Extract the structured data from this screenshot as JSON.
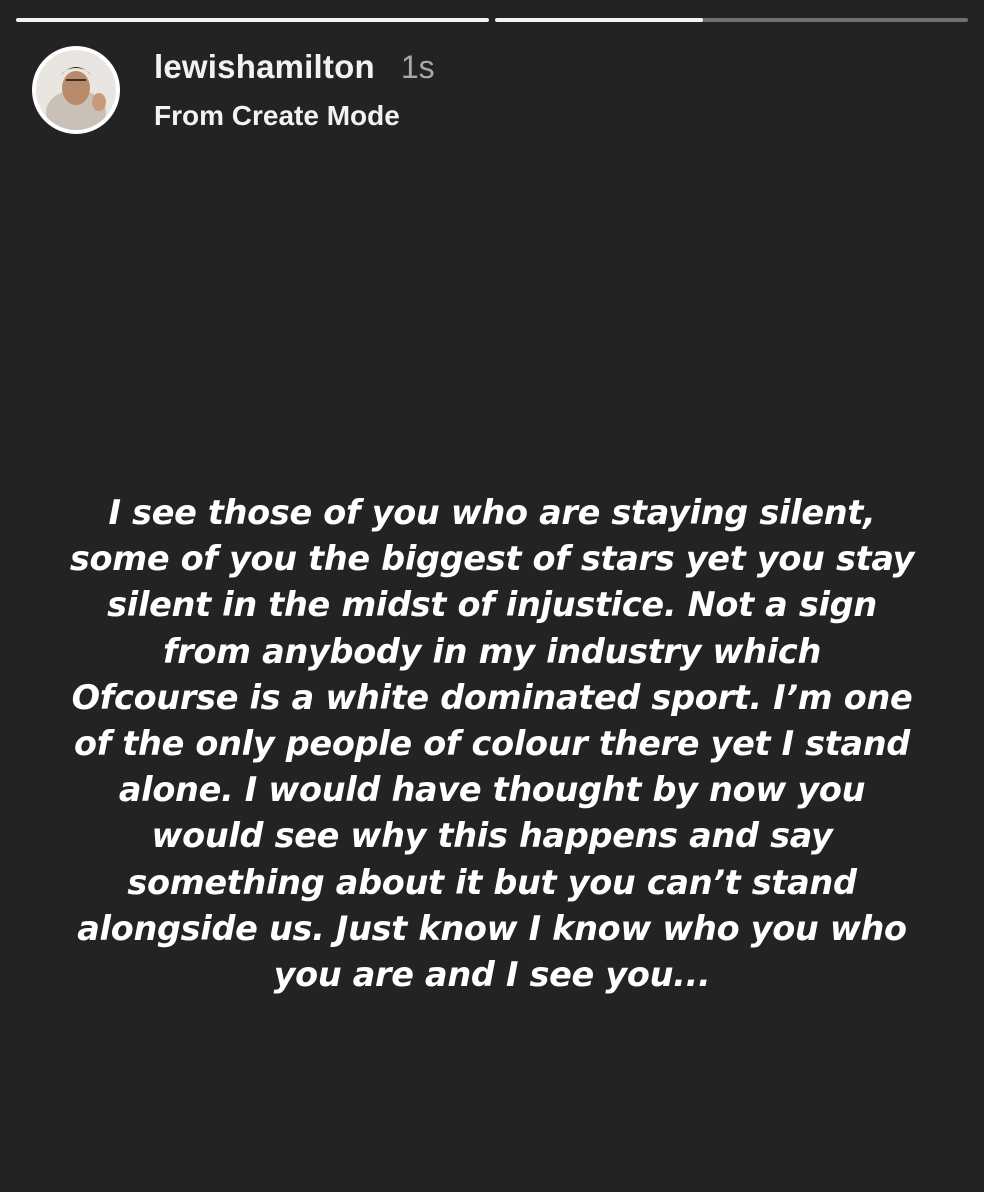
{
  "progress": {
    "segments": [
      {
        "fill": 1.0
      },
      {
        "fill": 0.44
      }
    ]
  },
  "header": {
    "avatar_icon": "profile-photo",
    "username": "lewishamilton",
    "time": "1s",
    "subtitle": "From Create Mode"
  },
  "story": {
    "lines": [
      "I see those of you who are staying silent,",
      "some of you the biggest of stars yet you stay",
      "silent in the midst of injustice. Not a sign",
      "from anybody in my industry which",
      "Ofcourse is a white dominated sport. I’m one",
      "of the only people of colour there yet I stand",
      "alone. I would have thought by now you",
      "would see why this happens and say",
      "something about it but you can’t stand",
      "alongside us. Just know I know who you who",
      "you are and I see you..."
    ]
  },
  "colors": {
    "background": "#232323",
    "text": "#ffffff",
    "muted": "#a9a9a9"
  }
}
